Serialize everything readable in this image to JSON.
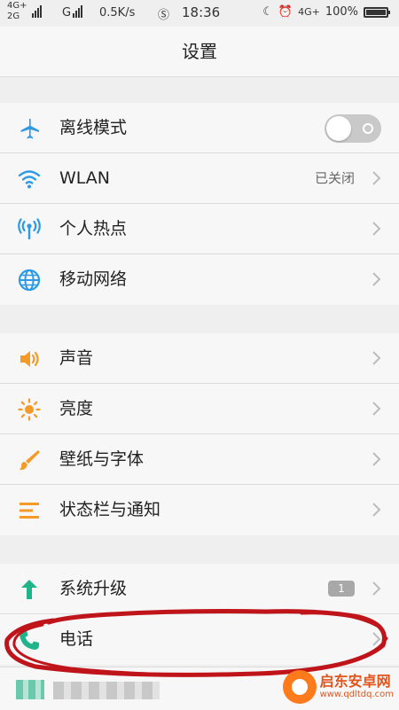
{
  "status_bar": {
    "net1": "4G+",
    "net2": "2G",
    "net3": "G",
    "speed": "0.5K/s",
    "time": "18:36",
    "net_right": "4G+",
    "battery": "100%"
  },
  "header": {
    "title": "设置"
  },
  "groups": [
    {
      "items": [
        {
          "icon": "airplane-icon",
          "label": "离线模式",
          "control": "toggle",
          "toggle_on": false
        },
        {
          "icon": "wifi-icon",
          "label": "WLAN",
          "value": "已关闭"
        },
        {
          "icon": "hotspot-icon",
          "label": "个人热点"
        },
        {
          "icon": "globe-icon",
          "label": "移动网络"
        }
      ]
    },
    {
      "items": [
        {
          "icon": "speaker-icon",
          "label": "声音"
        },
        {
          "icon": "brightness-icon",
          "label": "亮度"
        },
        {
          "icon": "brush-icon",
          "label": "壁纸与字体"
        },
        {
          "icon": "statusbar-icon",
          "label": "状态栏与通知"
        }
      ]
    },
    {
      "items": [
        {
          "icon": "upgrade-arrow-icon",
          "label": "系统升级",
          "badge": "1"
        },
        {
          "icon": "phone-icon",
          "label": "电话"
        }
      ]
    }
  ],
  "watermark": {
    "name": "启东安卓网",
    "url": "www.qdltdq.com"
  },
  "colors": {
    "accent_blue": "#2e9ae6",
    "accent_orange": "#f39a27",
    "accent_green": "#1fb48a",
    "annotation_red": "#c0141b"
  }
}
